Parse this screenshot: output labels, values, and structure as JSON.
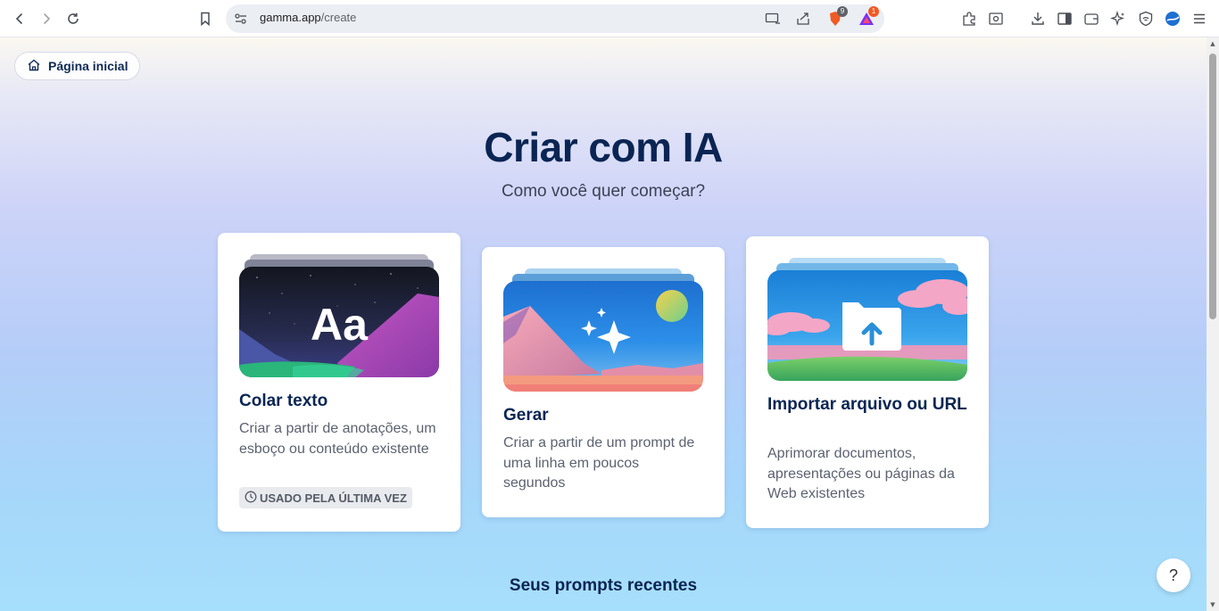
{
  "browser": {
    "url_domain": "gamma.app",
    "url_path": "/create",
    "brave_badge": "9",
    "alert_badge": "1"
  },
  "nav": {
    "home_label": "Página inicial"
  },
  "hero": {
    "title": "Criar com IA",
    "subtitle": "Como você quer começar?"
  },
  "cards": [
    {
      "title": "Colar texto",
      "description": "Criar a partir de anotações, um esboço ou conteúdo existente",
      "art_text": "Aa",
      "badge": "USADO PELA ÚLTIMA VEZ"
    },
    {
      "title": "Gerar",
      "description": "Criar a partir de um prompt de uma linha em poucos segundos"
    },
    {
      "title": "Importar arquivo ou URL",
      "description": "Aprimorar documentos, apresentações ou páginas da Web existentes"
    }
  ],
  "recent": {
    "heading": "Seus prompts recentes"
  },
  "help": {
    "label": "?"
  },
  "colors": {
    "heading": "#0a2553",
    "body_text": "#5b6270",
    "card_bg": "#ffffff"
  }
}
